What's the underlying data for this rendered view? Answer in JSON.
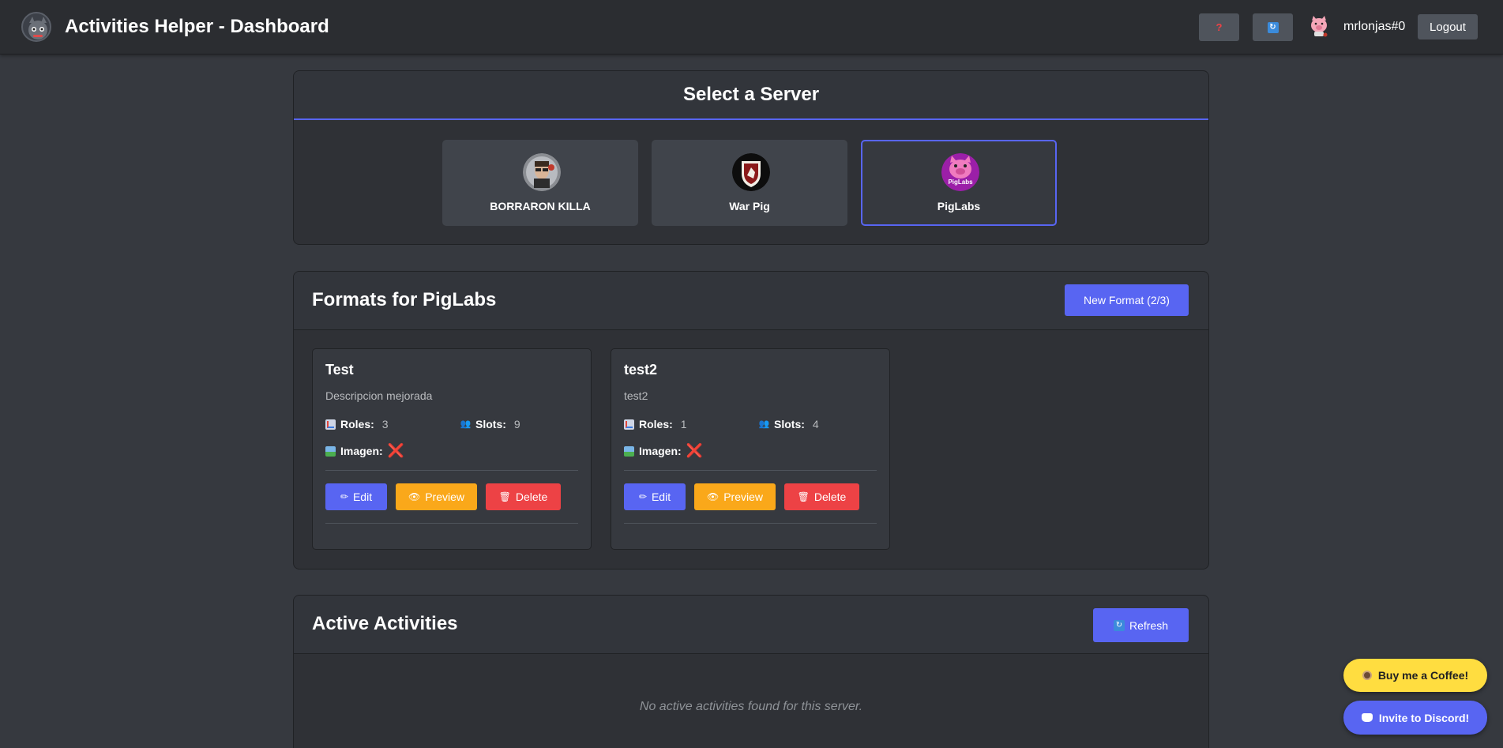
{
  "app": {
    "title": "Activities Helper - Dashboard"
  },
  "topbar": {
    "help_label": "?",
    "sync_label": "↻",
    "username": "mrlonjas#0",
    "logout_label": "Logout"
  },
  "server_select": {
    "title": "Select a Server",
    "servers": [
      {
        "name": "BORRARON KILLA",
        "selected": false
      },
      {
        "name": "War Pig",
        "selected": false
      },
      {
        "name": "PigLabs",
        "selected": true,
        "icon_text": "PigLabs"
      }
    ]
  },
  "formats": {
    "title": "Formats for PigLabs",
    "new_button": "New Format (2/3)",
    "cards": [
      {
        "title": "Test",
        "description": "Descripcion mejorada",
        "roles_label": "Roles:",
        "roles_value": "3",
        "slots_label": "Slots:",
        "slots_value": "9",
        "image_label": "Imagen:",
        "image_value": "❌",
        "edit": "Edit",
        "preview": "Preview",
        "delete": "Delete"
      },
      {
        "title": "test2",
        "description": "test2",
        "roles_label": "Roles:",
        "roles_value": "1",
        "slots_label": "Slots:",
        "slots_value": "4",
        "image_label": "Imagen:",
        "image_value": "❌",
        "edit": "Edit",
        "preview": "Preview",
        "delete": "Delete"
      }
    ]
  },
  "activities": {
    "title": "Active Activities",
    "refresh": "Refresh",
    "empty": "No active activities found for this server."
  },
  "floating": {
    "coffee": "Buy me a Coffee!",
    "discord": "Invite to Discord!"
  },
  "colors": {
    "background": "#36393f",
    "panel": "#2f3136",
    "accent": "#5865f2",
    "warning": "#faa81a",
    "danger": "#ed4245",
    "coffee": "#ffdd40"
  }
}
